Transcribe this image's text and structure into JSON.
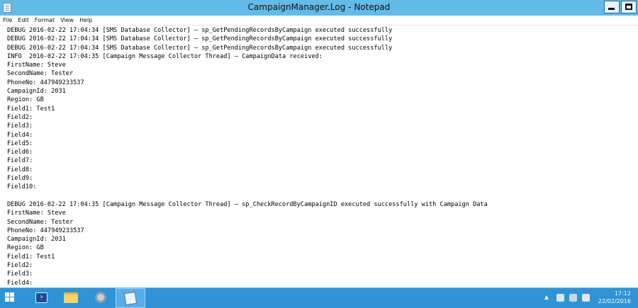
{
  "window": {
    "title": "CampaignManager.Log - Notepad"
  },
  "menu": [
    {
      "label": "File"
    },
    {
      "label": "Edit"
    },
    {
      "label": "Format"
    },
    {
      "label": "View"
    },
    {
      "label": "Help"
    }
  ],
  "log_lines": [
    "DEBUG 2016-02-22 17:04:34 [SMS Database Collector] – sp_GetPendingRecordsByCampaign executed successfully",
    "DEBUG 2016-02-22 17:04:34 [SMS Database Collector] – sp_GetPendingRecordsByCampaign executed successfully",
    "DEBUG 2016-02-22 17:04:34 [SMS Database Collector] – sp_GetPendingRecordsByCampaign executed successfully",
    "INFO  2016-02-22 17:04:35 [Campaign Message Collector Thread] – CampaignData received:",
    "FirstName: Steve",
    "SecondName: Tester",
    "PhoneNo: 447949233537",
    "CampaignId: 2031",
    "Region: GB",
    "Field1: Test1",
    "Field2:",
    "Field3:",
    "Field4:",
    "Field5:",
    "Field6:",
    "Field7:",
    "Field8:",
    "Field9:",
    "Field10:",
    "",
    "DEBUG 2016-02-22 17:04:35 [Campaign Message Collector Thread] – sp_CheckRecordByCampaignID executed successfully with Campaign Data",
    "FirstName: Steve",
    "SecondName: Tester",
    "PhoneNo: 447949233537",
    "CampaignId: 2031",
    "Region: GB",
    "Field1: Test1",
    "Field2:",
    "Field3:",
    "Field4:"
  ],
  "taskbar": {
    "items": [
      {
        "icon": "powershell-icon"
      },
      {
        "icon": "file-explorer-icon"
      },
      {
        "icon": "server-manager-icon"
      },
      {
        "icon": "notepad-icon"
      }
    ],
    "clock": {
      "time": "17:12",
      "date": "22/02/2016"
    }
  },
  "colors": {
    "titlebar": "#62bbe8",
    "taskbar": "#2f93d6"
  }
}
